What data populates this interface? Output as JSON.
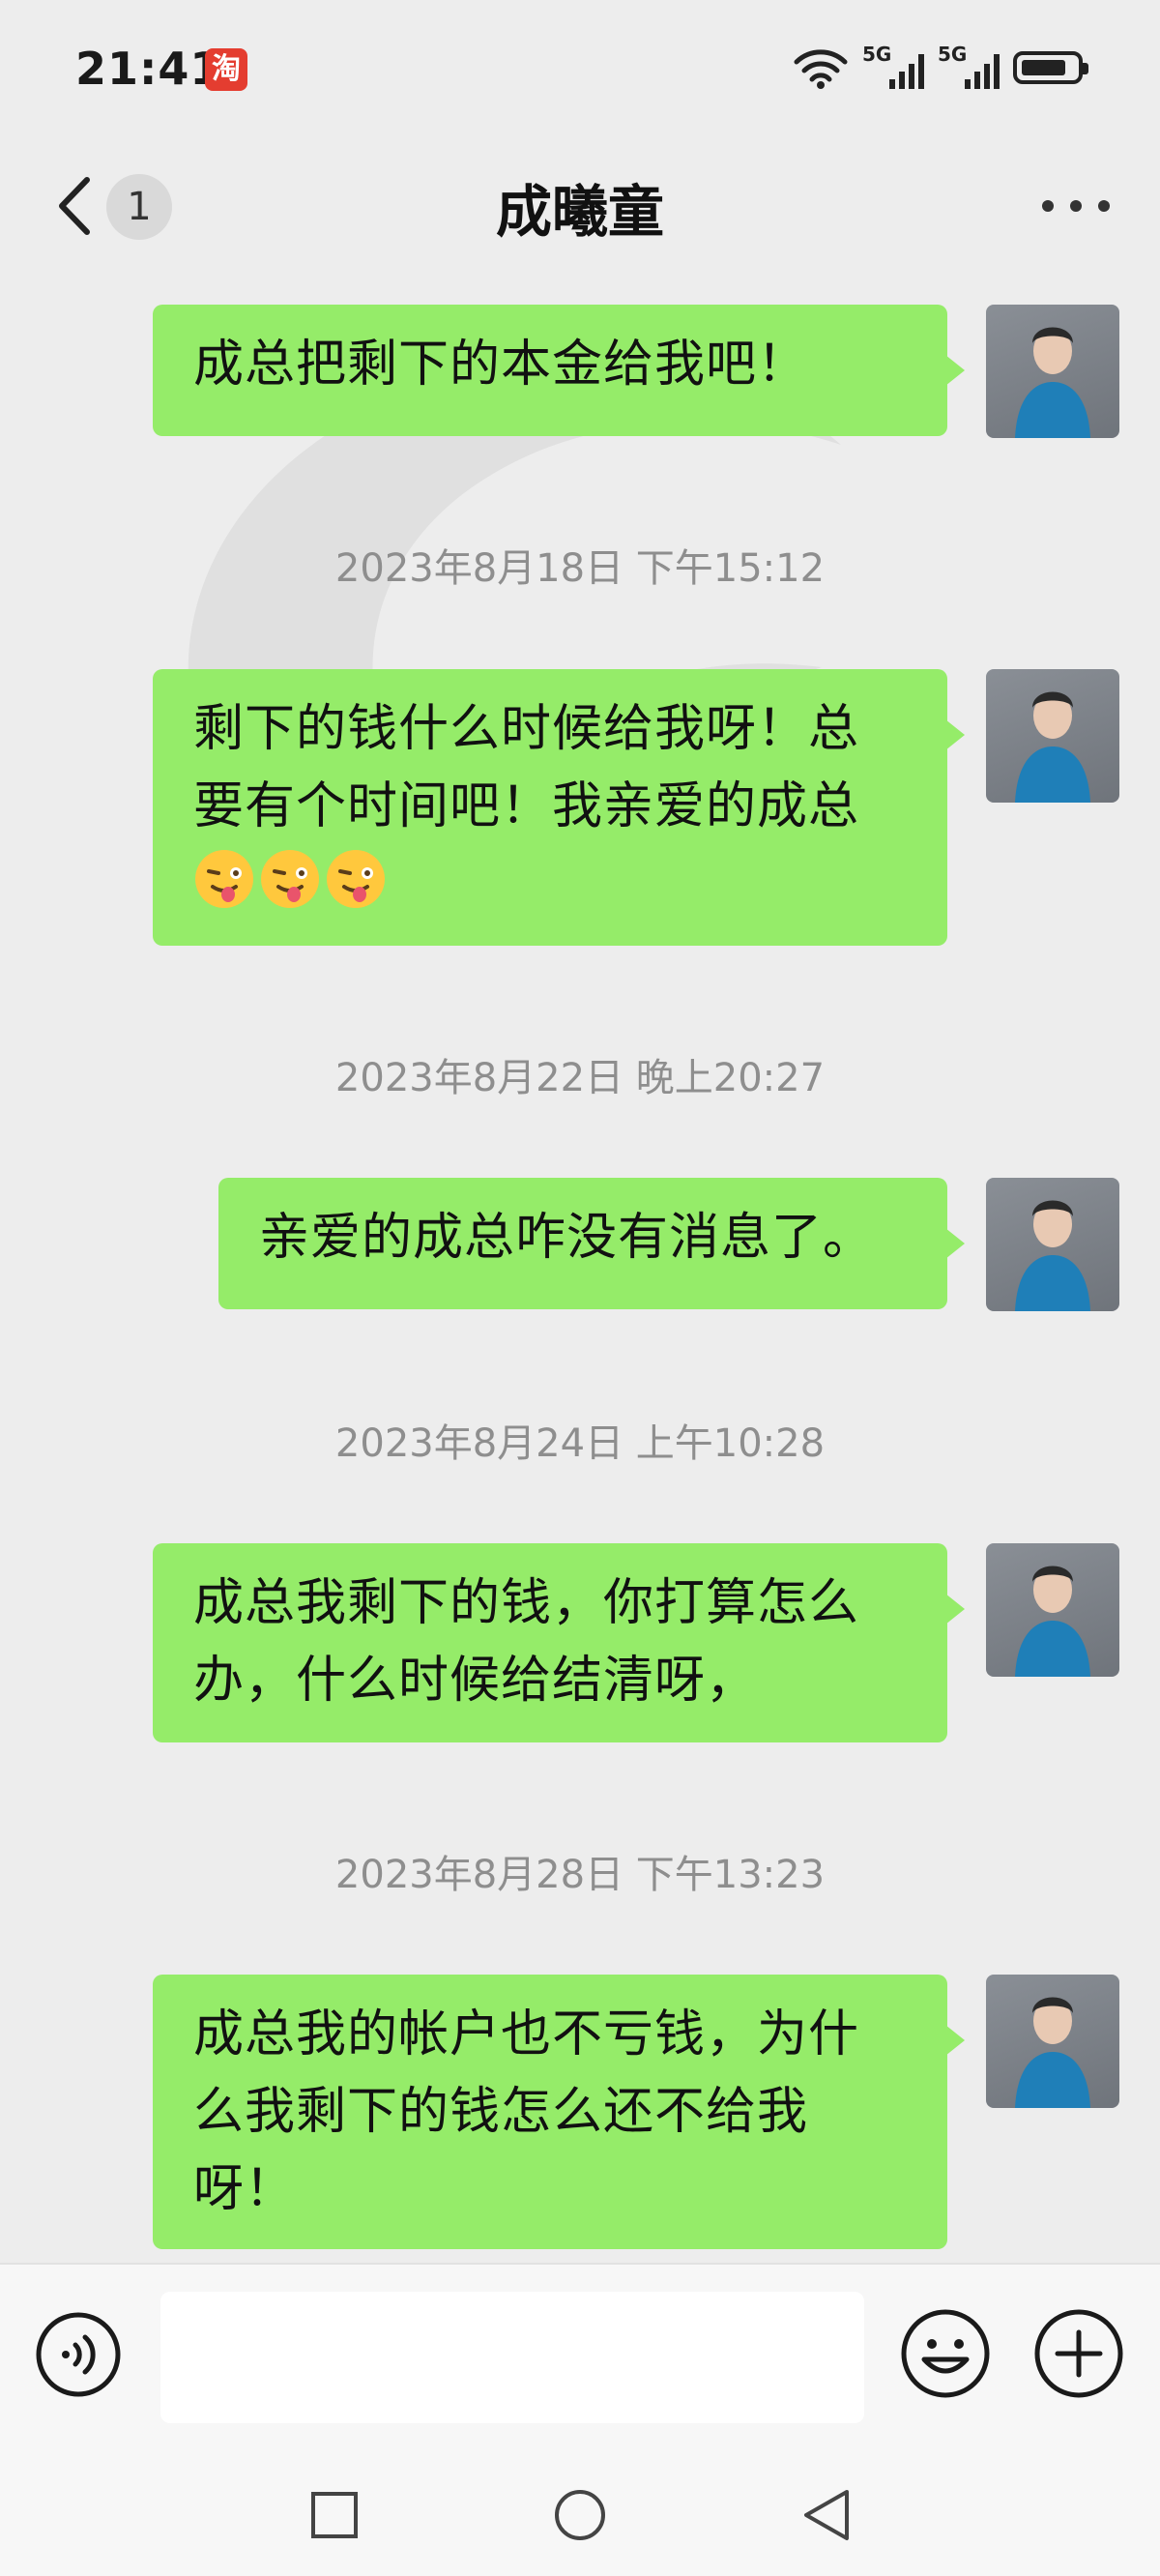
{
  "status_bar": {
    "time": "21:41",
    "app_badge": "淘",
    "signal_1_label": "5G",
    "signal_2_label": "5G",
    "icons": [
      "wifi-icon",
      "signal-icon",
      "signal-icon",
      "battery-icon"
    ]
  },
  "header": {
    "title": "成曦童",
    "unread_count": "1",
    "icons": [
      "back-chevron-icon",
      "more-dots-icon"
    ]
  },
  "messages": [
    {
      "type": "sent",
      "lines": [
        "成总把剩下的本金给我吧！"
      ]
    },
    {
      "type": "timestamp",
      "text": "2023年8月18日 下午15:12"
    },
    {
      "type": "sent",
      "lines": [
        "剩下的钱什么时候给我呀！总",
        "要有个时间吧！我亲爱的成总"
      ],
      "emoji_line": [
        "winking-tongue-emoji",
        "winking-tongue-emoji",
        "winking-tongue-emoji"
      ]
    },
    {
      "type": "timestamp",
      "text": "2023年8月22日 晚上20:27"
    },
    {
      "type": "sent",
      "lines": [
        "亲爱的成总咋没有消息了。"
      ]
    },
    {
      "type": "timestamp",
      "text": "2023年8月24日 上午10:28"
    },
    {
      "type": "sent",
      "lines": [
        "成总我剩下的钱，你打算怎么",
        "办，什么时候给结清呀，"
      ]
    },
    {
      "type": "timestamp",
      "text": "2023年8月28日 下午13:23"
    },
    {
      "type": "sent",
      "lines": [
        "成总我的帐户也不亏钱，为什",
        "么我剩下的钱怎么还不给我",
        "呀！"
      ]
    }
  ],
  "input_bar": {
    "text_value": "",
    "icons": [
      "voice-icon",
      "emoji-icon",
      "plus-icon"
    ]
  },
  "nav_bar": {
    "icons": [
      "recent-apps-icon",
      "home-icon",
      "back-triangle-icon"
    ]
  },
  "colors": {
    "background": "#EDEDED",
    "bubble": "#95EC69",
    "timestamp": "#8E8E8E",
    "bar": "#F7F7F7",
    "taobao_badge": "#E43D30"
  }
}
